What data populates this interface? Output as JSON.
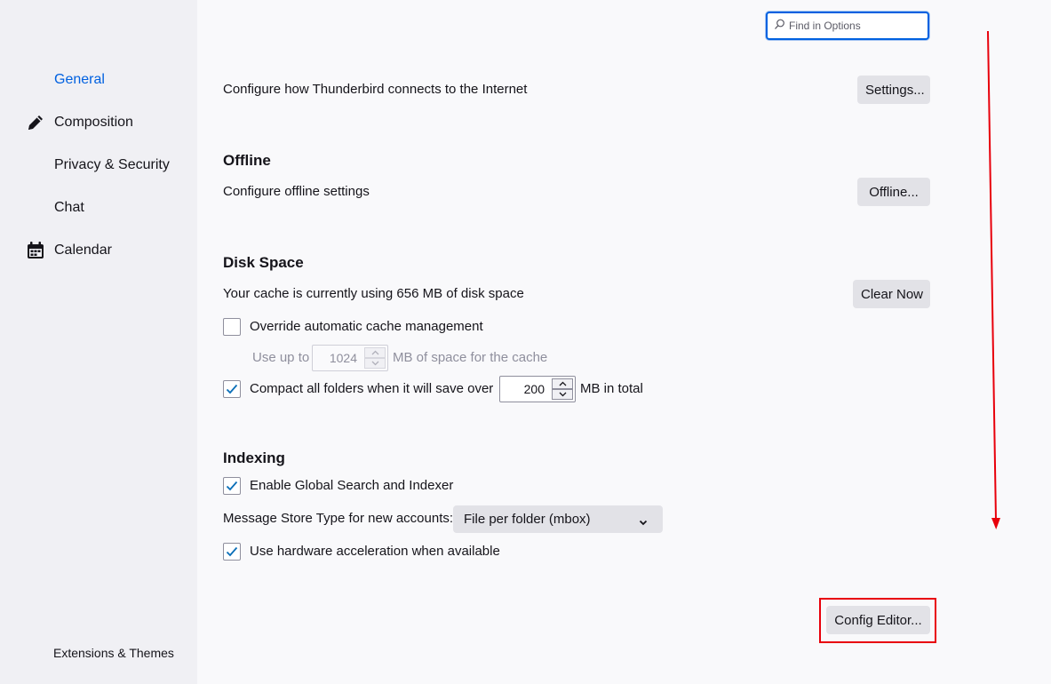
{
  "sidebar": {
    "items": [
      {
        "label": "General",
        "icon": "gear-icon",
        "selected": true
      },
      {
        "label": "Composition",
        "icon": "pencil-icon"
      },
      {
        "label": "Privacy & Security",
        "icon": "lock-icon"
      },
      {
        "label": "Chat",
        "icon": "chat-icon"
      },
      {
        "label": "Calendar",
        "icon": "calendar-icon"
      }
    ],
    "extensions_label": "Extensions & Themes"
  },
  "search": {
    "placeholder": "Find in Options",
    "value": ""
  },
  "connection": {
    "description": "Configure how Thunderbird connects to the Internet",
    "button_label": "Settings..."
  },
  "offline": {
    "heading": "Offline",
    "description": "Configure offline settings",
    "button_label": "Offline..."
  },
  "disk_space": {
    "heading": "Disk Space",
    "cache_usage": "Your cache is currently using 656 MB of disk space",
    "clear_button_label": "Clear Now",
    "override_label": "Override automatic cache management",
    "override_checked": false,
    "use_up_to_label": "Use up to",
    "cache_size_value": "1024",
    "cache_size_suffix": "MB of space for the cache",
    "compact_label": "Compact all folders when it will save over",
    "compact_checked": true,
    "compact_value": "200",
    "compact_suffix": "MB in total"
  },
  "indexing": {
    "heading": "Indexing",
    "global_search_label": "Enable Global Search and Indexer",
    "global_search_checked": true,
    "store_type_label": "Message Store Type for new accounts:",
    "store_type_value": "File per folder (mbox)",
    "hw_accel_label": "Use hardware acceleration when available",
    "hw_accel_checked": true
  },
  "config_editor_label": "Config Editor...",
  "colors": {
    "accent": "#0061e0",
    "annotation": "#e8000b",
    "check": "#0b6fb8"
  }
}
